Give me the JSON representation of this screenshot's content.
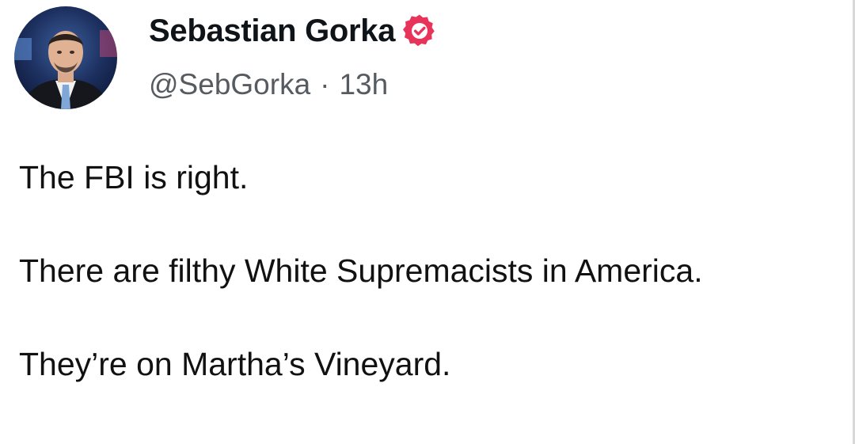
{
  "author": {
    "display_name": "Sebastian Gorka",
    "handle": "@SebGorka",
    "separator": "·",
    "timestamp": "13h",
    "verified_icon": "verified-badge-icon",
    "badge_color": "#e8345a"
  },
  "post": {
    "lines": [
      "The FBI is right.",
      "There are filthy White Supremacists in America.",
      "They’re on Martha’s Vineyard."
    ]
  }
}
